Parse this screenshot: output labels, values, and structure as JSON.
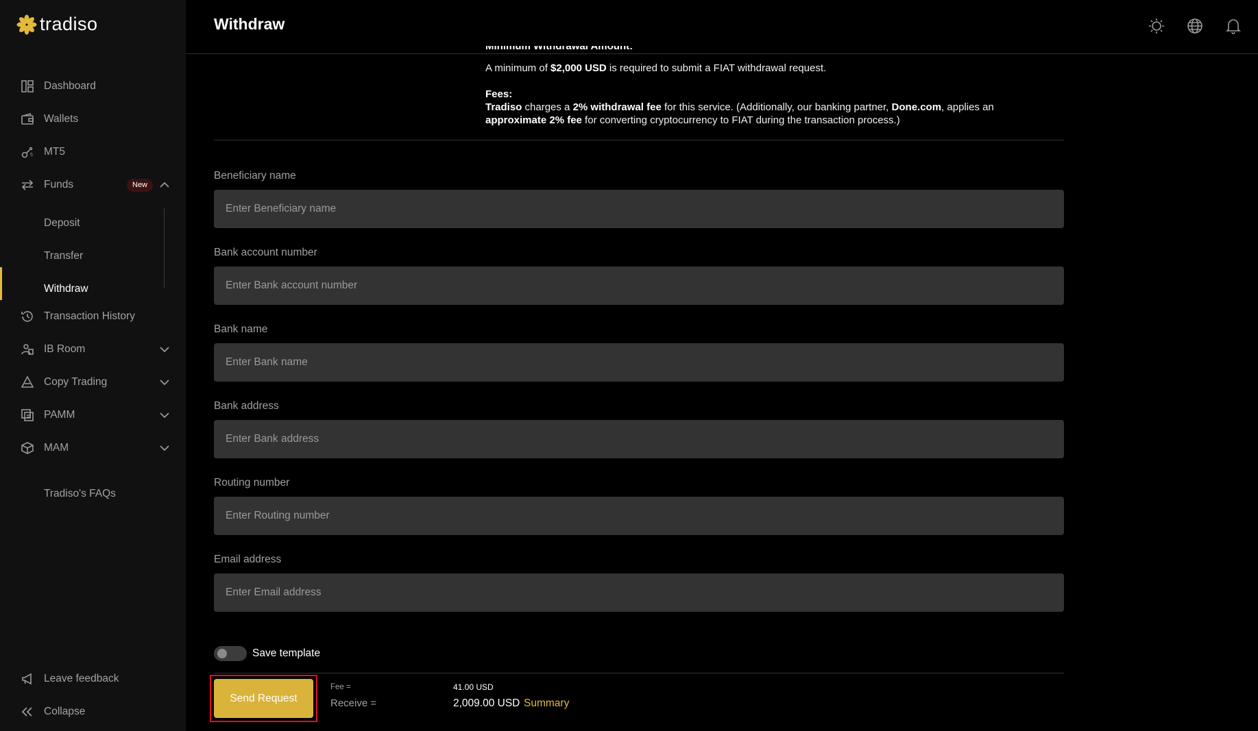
{
  "brand": {
    "name": "tradiso",
    "accent": "#e2b93b"
  },
  "sidebar": {
    "items": [
      {
        "label": "Dashboard",
        "icon": "dashboard-icon"
      },
      {
        "label": "Wallets",
        "icon": "wallet-icon"
      },
      {
        "label": "MT5",
        "icon": "mt5-icon"
      },
      {
        "label": "Funds",
        "icon": "transfer-arrows-icon",
        "badge": "New"
      },
      {
        "label": "Transaction History",
        "icon": "history-icon"
      },
      {
        "label": "IB Room",
        "icon": "ib-room-icon"
      },
      {
        "label": "Copy Trading",
        "icon": "copy-trading-icon"
      },
      {
        "label": "PAMM",
        "icon": "pamm-icon"
      },
      {
        "label": "MAM",
        "icon": "mam-icon"
      }
    ],
    "funds_sub": [
      {
        "label": "Deposit"
      },
      {
        "label": "Transfer"
      },
      {
        "label": "Withdraw"
      }
    ],
    "faqs": "Tradiso's FAQs",
    "feedback": "Leave feedback",
    "collapse": "Collapse"
  },
  "header": {
    "title": "Withdraw"
  },
  "info": {
    "min_heading": "Minimum Withdrawal Amount:",
    "min_pre": "A minimum of ",
    "min_amount": "$2,000 USD",
    "min_post": " is required to submit a FIAT withdrawal request.",
    "fees_heading": "Fees:",
    "fees_brand": "Tradiso",
    "fees_t1": " charges a ",
    "fees_pct": "2% withdrawal fee",
    "fees_t2": " for this service. (Additionally, our banking partner, ",
    "fees_partner": "Done.com",
    "fees_t3": ", applies an ",
    "fees_approx": "approximate 2% fee",
    "fees_t4": " for converting cryptocurrency to FIAT during the transaction process.)"
  },
  "form": {
    "fields": [
      {
        "label": "Beneficiary name",
        "placeholder": "Enter Beneficiary name",
        "value": ""
      },
      {
        "label": "Bank account number",
        "placeholder": "Enter Bank account number",
        "value": ""
      },
      {
        "label": "Bank name",
        "placeholder": "Enter Bank name",
        "value": ""
      },
      {
        "label": "Bank address",
        "placeholder": "Enter Bank address",
        "value": ""
      },
      {
        "label": "Routing number",
        "placeholder": "Enter Routing number",
        "value": ""
      },
      {
        "label": "Email address",
        "placeholder": "Enter Email address",
        "value": ""
      }
    ],
    "save_template": "Save template",
    "save_template_on": false,
    "send_label": "Send Request"
  },
  "summary": {
    "fee_label": "Fee =",
    "fee_value": "41.00 USD",
    "receive_label": "Receive =",
    "receive_value": "2,009.00 USD",
    "summary_link": "Summary"
  }
}
